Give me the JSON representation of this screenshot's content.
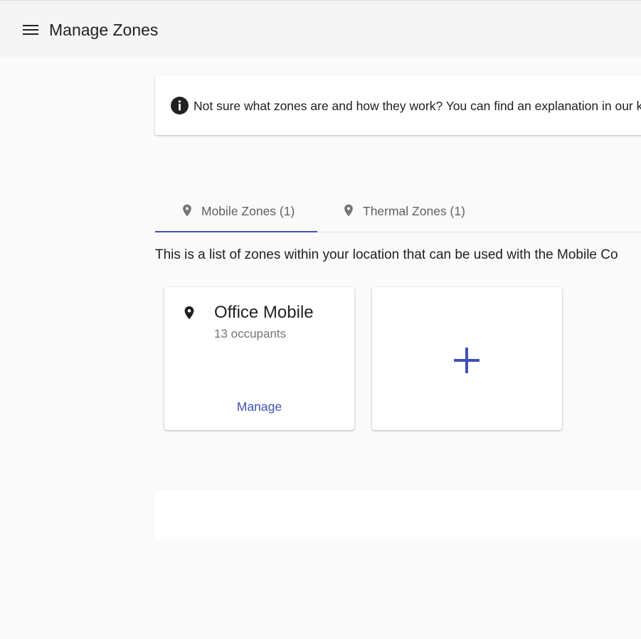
{
  "header": {
    "menu_icon": "hamburger-menu-icon",
    "title": "Manage Zones"
  },
  "info_banner": {
    "icon": "info-icon",
    "text": "Not sure what zones are and how they work? You can find an explanation in our kn"
  },
  "tabs": [
    {
      "icon": "location-pin-icon",
      "label": "Mobile Zones (1)",
      "active": true
    },
    {
      "icon": "location-pin-icon",
      "label": "Thermal Zones (1)",
      "active": false
    }
  ],
  "description": "This is a list of zones within your location that can be used with the Mobile Co",
  "zones": [
    {
      "icon": "location-pin-icon",
      "name": "Office Mobile",
      "occupants": "13 occupants",
      "action_label": "Manage"
    }
  ],
  "add_card": {
    "icon": "plus-icon"
  },
  "colors": {
    "accent": "#3f51b5",
    "header_bg": "#f5f5f5",
    "page_bg": "#fafafa",
    "tab_icon": "#757575"
  }
}
